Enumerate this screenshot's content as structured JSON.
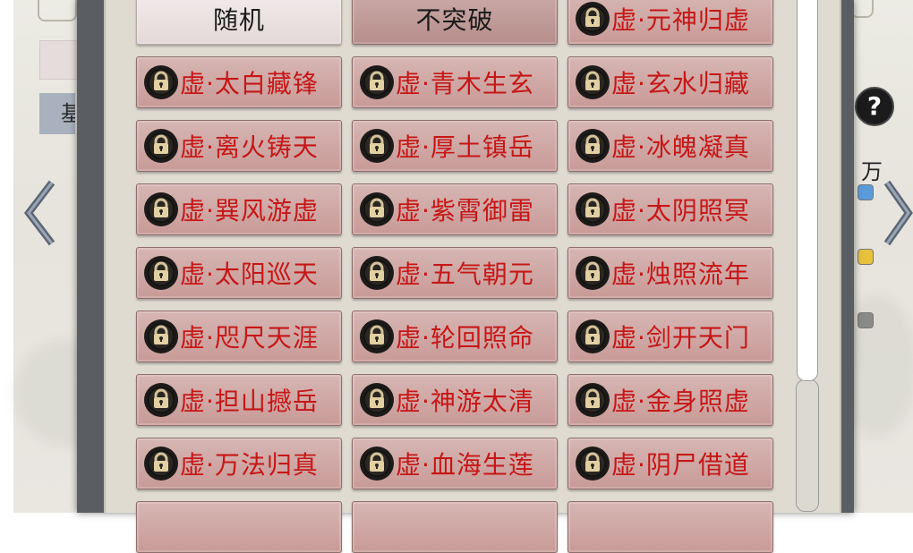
{
  "background": {
    "left_tab_label": "基",
    "help_label": "?",
    "side_label": "万"
  },
  "options": [
    {
      "label": "随机",
      "locked": false,
      "selected": true
    },
    {
      "label": "不突破",
      "locked": false,
      "selected": false
    },
    {
      "label": "虚·元神归虚",
      "locked": true,
      "selected": false
    },
    {
      "label": "虚·太白藏锋",
      "locked": true,
      "selected": false
    },
    {
      "label": "虚·青木生玄",
      "locked": true,
      "selected": false
    },
    {
      "label": "虚·玄水归藏",
      "locked": true,
      "selected": false
    },
    {
      "label": "虚·离火铸天",
      "locked": true,
      "selected": false
    },
    {
      "label": "虚·厚土镇岳",
      "locked": true,
      "selected": false
    },
    {
      "label": "虚·冰魄凝真",
      "locked": true,
      "selected": false
    },
    {
      "label": "虚·巽风游虚",
      "locked": true,
      "selected": false
    },
    {
      "label": "虚·紫霄御雷",
      "locked": true,
      "selected": false
    },
    {
      "label": "虚·太阴照冥",
      "locked": true,
      "selected": false
    },
    {
      "label": "虚·太阳巡天",
      "locked": true,
      "selected": false
    },
    {
      "label": "虚·五气朝元",
      "locked": true,
      "selected": false
    },
    {
      "label": "虚·烛照流年",
      "locked": true,
      "selected": false
    },
    {
      "label": "虚·咫尺天涯",
      "locked": true,
      "selected": false
    },
    {
      "label": "虚·轮回照命",
      "locked": true,
      "selected": false
    },
    {
      "label": "虚·剑开天门",
      "locked": true,
      "selected": false
    },
    {
      "label": "虚·担山撼岳",
      "locked": true,
      "selected": false
    },
    {
      "label": "虚·神游太清",
      "locked": true,
      "selected": false
    },
    {
      "label": "虚·金身照虚",
      "locked": true,
      "selected": false
    },
    {
      "label": "虚·万法归真",
      "locked": true,
      "selected": false
    },
    {
      "label": "虚·血海生莲",
      "locked": true,
      "selected": false
    },
    {
      "label": "虚·阴尸借道",
      "locked": true,
      "selected": false
    }
  ],
  "colors": {
    "locked_text": "#c71616",
    "button_bg": "#c89a97",
    "panel_frame": "#5a5e62"
  },
  "icons": {
    "lock": "padlock-icon",
    "left": "chevron-left-icon",
    "right": "chevron-right-icon",
    "help": "question-icon"
  }
}
